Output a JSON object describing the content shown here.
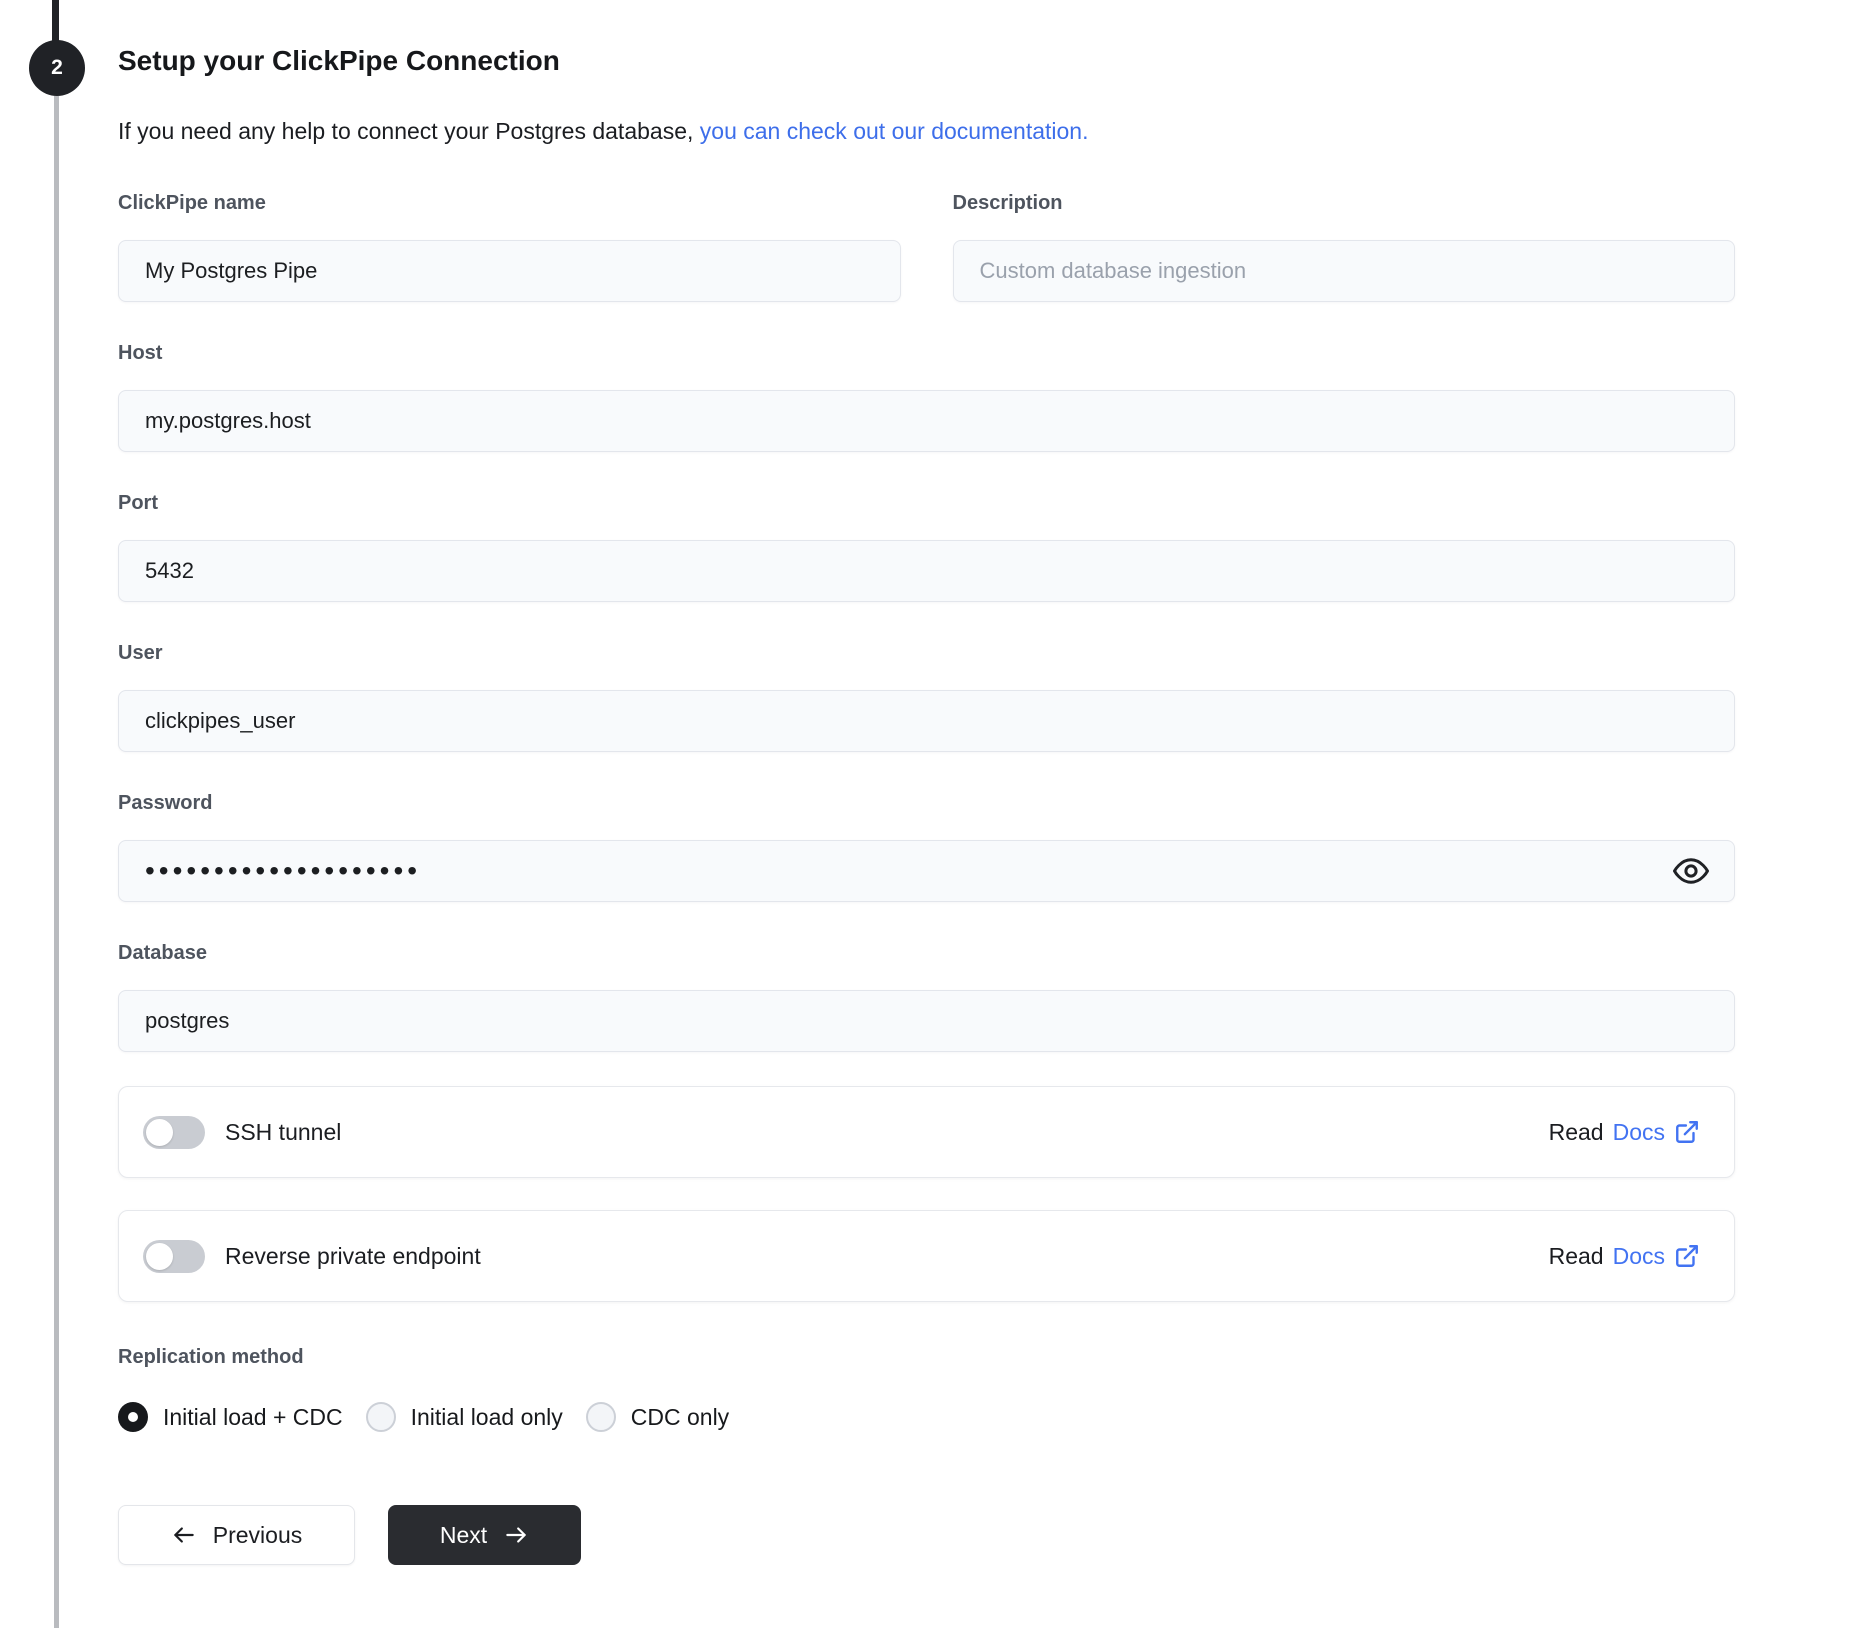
{
  "step": {
    "number": "2",
    "title": "Setup your ClickPipe Connection",
    "subtitle_prefix": "If you need any help to connect your Postgres database,",
    "subtitle_link": "you can check out our documentation."
  },
  "fields": {
    "clickpipe_name": {
      "label": "ClickPipe name",
      "value": "My Postgres Pipe"
    },
    "description": {
      "label": "Description",
      "value": "",
      "placeholder": "Custom database ingestion"
    },
    "host": {
      "label": "Host",
      "value": "my.postgres.host"
    },
    "port": {
      "label": "Port",
      "value": "5432"
    },
    "user": {
      "label": "User",
      "value": "clickpipes_user"
    },
    "password": {
      "label": "Password",
      "masked_value": "••••••••••••••••••••",
      "eye_icon": "eye-icon"
    },
    "database": {
      "label": "Database",
      "value": "postgres"
    }
  },
  "toggles": [
    {
      "label": "SSH tunnel",
      "state": "off",
      "read_label": "Read",
      "docs_label": "Docs",
      "icon": "external-link-icon"
    },
    {
      "label": "Reverse private endpoint",
      "state": "off",
      "read_label": "Read",
      "docs_label": "Docs",
      "icon": "external-link-icon"
    }
  ],
  "replication": {
    "label": "Replication method",
    "options": [
      {
        "label": "Initial load + CDC",
        "selected": true
      },
      {
        "label": "Initial load only",
        "selected": false
      },
      {
        "label": "CDC only",
        "selected": false
      }
    ]
  },
  "actions": {
    "previous_label": "Previous",
    "next_label": "Next"
  },
  "colors": {
    "accent_link_blue": "#3d6eea",
    "docs_blue": "#4273f2",
    "dark_text": "#1b1d21",
    "label_gray": "#4e545e",
    "input_bg": "#f8fafc",
    "input_border": "#e3e6ec",
    "toggle_track": "#c9ccd2",
    "step_circle": "#202226",
    "next_button_bg": "#2a2c30",
    "timeline_gray": "#b9bbbf"
  }
}
